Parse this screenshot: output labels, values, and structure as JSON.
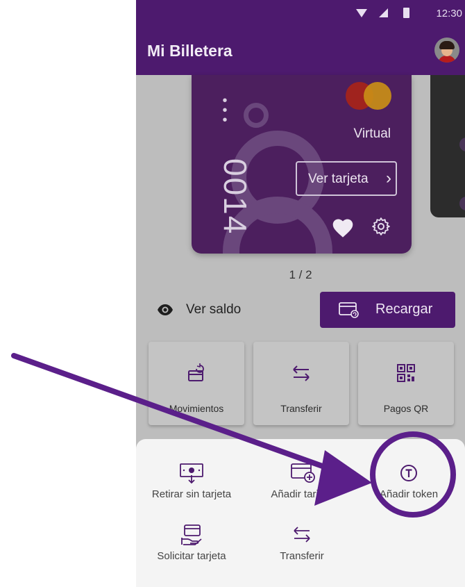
{
  "status_bar": {
    "time": "12:30"
  },
  "app_bar": {
    "title": "Mi Billetera"
  },
  "card": {
    "number_suffix": "0014",
    "masked_dots": "•\n•\n•",
    "type_label": "Virtual",
    "view_button_label": "Ver tarjeta",
    "view_button_chevron": "›"
  },
  "pager": {
    "text": "1 / 2"
  },
  "balance": {
    "toggle_label": "Ver saldo"
  },
  "recharge_button": {
    "label": "Recargar"
  },
  "quick_actions": [
    {
      "label": "Movimientos",
      "icon": "wallet-refresh-icon"
    },
    {
      "label": "Transferir",
      "icon": "swap-arrows-icon"
    },
    {
      "label": "Pagos QR",
      "icon": "qr-code-icon"
    }
  ],
  "bottom_sheet": {
    "items": [
      {
        "label": "Retirar sin tarjeta",
        "icon": "cash-withdraw-icon"
      },
      {
        "label": "Añadir tarjeta",
        "icon": "add-card-icon"
      },
      {
        "label": "Añadir token",
        "icon": "token-icon"
      },
      {
        "label": "Solicitar tarjeta",
        "icon": "request-card-icon"
      },
      {
        "label": "Transferir",
        "icon": "swap-arrows-icon"
      }
    ]
  },
  "colors": {
    "primary": "#4d1a6e",
    "annotation": "#5b1f8a",
    "card": "#4c1f5e",
    "scrim": "#bdbdbd",
    "sheet": "#f4f4f4"
  }
}
